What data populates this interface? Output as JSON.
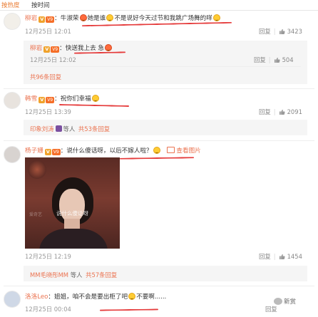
{
  "tabs": {
    "sort_by_hot": "按热度",
    "sort_by_time": "按时间"
  },
  "comments": [
    {
      "username": "柳岩",
      "text": "：牛淑荣",
      "text2": "她是谁",
      "text3": "不是说好今天过节和我跳广场舞的咩",
      "date": "12月25日 12:01",
      "reply_label": "回复",
      "likes": "3423",
      "sub_reply": {
        "username": "柳岩",
        "text": "：快送我上去 急",
        "date": "12月25日 12:02",
        "reply_label": "回复",
        "likes": "504"
      },
      "more_replies": "共96条回复"
    },
    {
      "username": "韩雪",
      "text": "：祝你们幸福",
      "date": "12月25日 13:39",
      "reply_label": "回复",
      "likes": "2091",
      "liked_by": "印象刘涛",
      "liked_by_suffix": "等人",
      "more_replies": "共53条回复"
    },
    {
      "username": "杨子姗",
      "text": "：说什么傻话呀，以后不嫁人啦？",
      "view_image": "查看图片",
      "image_caption": "说什么傻话呀",
      "image_watermark": "爱奇艺",
      "date": "12月25日 12:19",
      "reply_label": "回复",
      "likes": "1454",
      "liked_by": "MM毛晓彤MM",
      "liked_by_suffix": "等人",
      "more_replies": "共57条回复"
    },
    {
      "username": "洛洛Leo",
      "text": "：姐姐，咱不会是要出柜了吧",
      "text2": "不要啊......",
      "date": "12月25日 00:04",
      "reply_label": "回复"
    }
  ],
  "badges": {
    "verified": "V",
    "vip": "V9"
  },
  "watermark": {
    "brand": "新赏"
  },
  "colors": {
    "username": "#eb7350",
    "underline": "#e53b3b",
    "verified": "#f0a22b"
  }
}
